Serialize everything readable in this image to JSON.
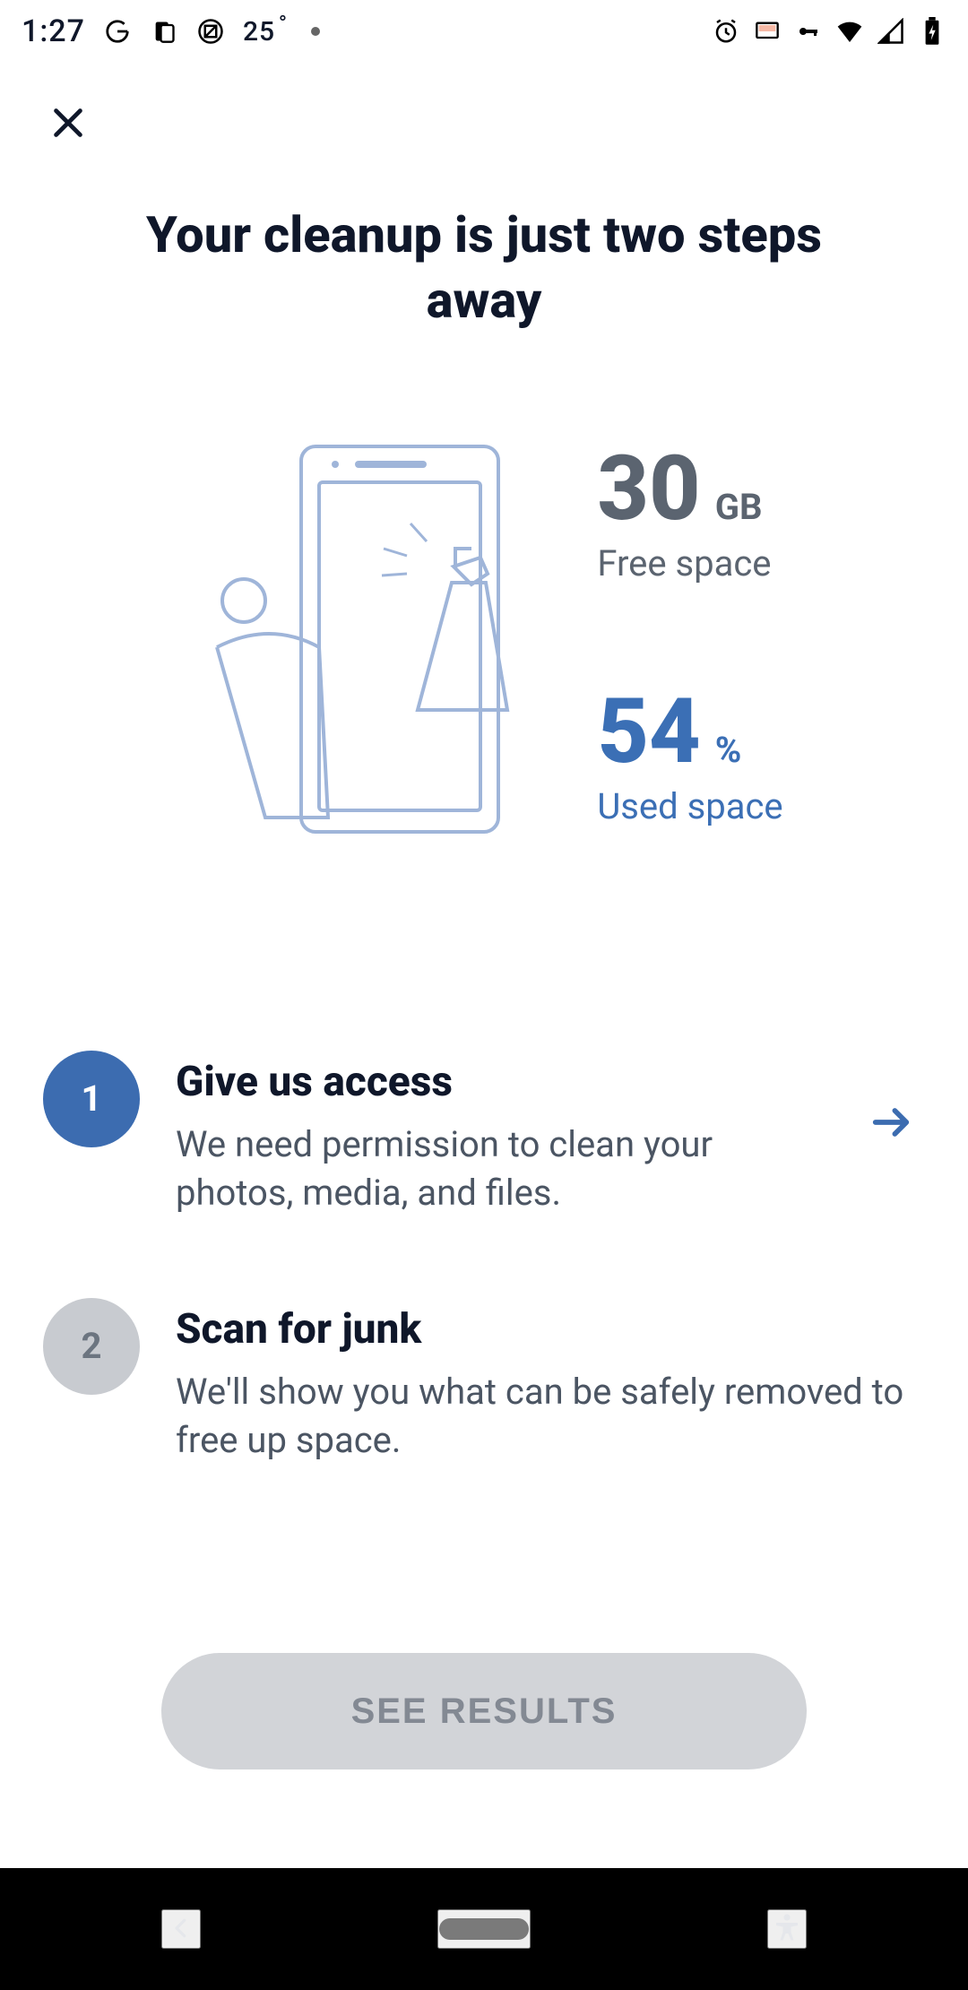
{
  "status_bar": {
    "time": "1:27",
    "temperature": "25"
  },
  "headline": "Your cleanup is just two steps away",
  "stats": {
    "free": {
      "value": "30",
      "unit": "GB",
      "label": "Free space"
    },
    "used": {
      "value": "54",
      "unit": "%",
      "label": "Used space"
    }
  },
  "steps": [
    {
      "number": "1",
      "title": "Give us access",
      "description": "We need permission to clean your photos, media, and files.",
      "active": true,
      "has_arrow": true
    },
    {
      "number": "2",
      "title": "Scan for junk",
      "description": "We'll show you what can be safely removed to free up space.",
      "active": false,
      "has_arrow": false
    }
  ],
  "cta_label": "SEE RESULTS",
  "colors": {
    "accent": "#3c6cb0",
    "muted": "#5b6470",
    "inactive": "#c8cbd0",
    "cta_bg": "#d2d4d8",
    "cta_text": "#838993",
    "used_color": "#3b6fb5"
  }
}
